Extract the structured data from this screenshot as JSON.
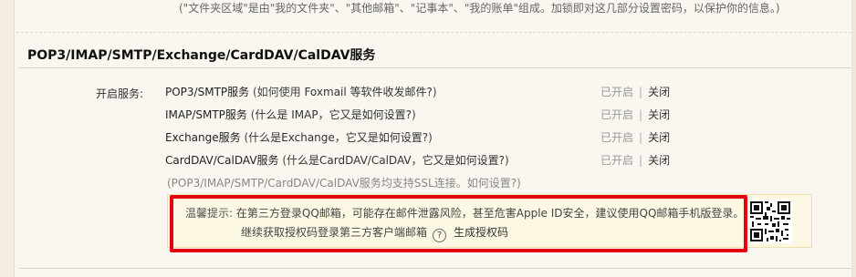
{
  "top_note": "(\"文件夹区域\"是由\"我的文件夹\"、\"其他邮箱\"、\"记事本\"、\"我的账单\"组成。加锁即对这几部分设置密码，以保护你的信息。)",
  "section": {
    "title": "POP3/IMAP/SMTP/Exchange/CardDAV/CalDAV服务"
  },
  "open_label": "开启服务:",
  "services": [
    {
      "name": "POP3/SMTP服务",
      "hint_prefix": " (如何使用 ",
      "hint_link": "Foxmail 等软件收发邮件?",
      "hint_suffix": ")",
      "on": "已开启",
      "sep": "|",
      "off": "关闭"
    },
    {
      "name": "IMAP/SMTP服务",
      "hint_prefix": " (",
      "hint_link": "什么是 IMAP，它又是如何设置?",
      "hint_suffix": ")",
      "on": "已开启",
      "sep": "|",
      "off": "关闭"
    },
    {
      "name": "Exchange服务",
      "hint_prefix": " (",
      "hint_link": "什么是Exchange，它又是如何设置?",
      "hint_suffix": ")",
      "on": "已开启",
      "sep": "|",
      "off": "关闭"
    },
    {
      "name": "CardDAV/CalDAV服务",
      "hint_prefix": " (",
      "hint_link": "什么是CardDAV/CalDAV，它又是如何设置?",
      "hint_suffix": ")",
      "on": "已开启",
      "sep": "|",
      "off": "关闭"
    }
  ],
  "ssl_note": "(POP3/IMAP/SMTP/CardDAV/CalDAV服务均支持SSL连接。如何设置?)",
  "warning": {
    "label": "温馨提示:",
    "line1": "在第三方登录QQ邮箱，可能存在邮件泄露风险，甚至危害Apple ID安全，建议使用QQ邮箱手机版登录。",
    "line2": "继续获取授权码登录第三方客户端邮箱",
    "help_glyph": "?",
    "generate_link": "生成授权码"
  },
  "colors": {
    "highlight_frame": "#e3000f",
    "warning_bg": "#fdf8e4",
    "page_bg": "#faf6f0"
  }
}
